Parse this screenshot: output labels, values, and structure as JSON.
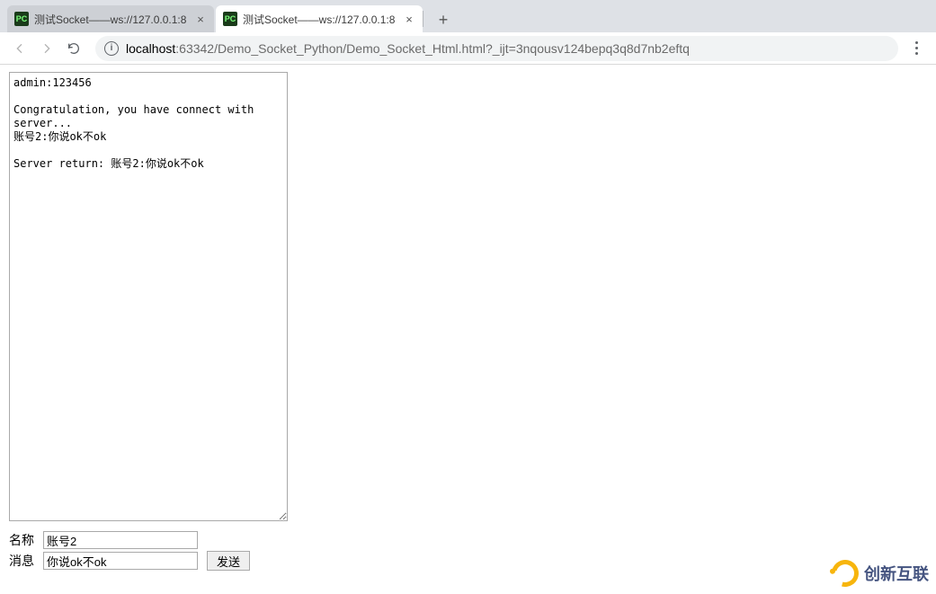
{
  "browser": {
    "tabs": [
      {
        "title": "测试Socket——ws://127.0.0.1:8",
        "favicon": "PC",
        "active": false
      },
      {
        "title": "测试Socket——ws://127.0.0.1:8",
        "favicon": "PC",
        "active": true
      }
    ],
    "url_host": "localhost",
    "url_port": ":63342",
    "url_path": "/Demo_Socket_Python/Demo_Socket_Html.html?_ijt=3nqousv124bepq3q8d7nb2eftq"
  },
  "log": {
    "lines": [
      "admin:123456",
      "",
      "Congratulation, you have connect with",
      "server...",
      "账号2:你说ok不ok",
      "",
      "Server return: 账号2:你说ok不ok"
    ]
  },
  "form": {
    "name_label": "名称",
    "name_value": "账号2",
    "message_label": "消息",
    "message_value": "你说ok不ok",
    "send_label": "发送"
  },
  "watermark": {
    "text": "创新互联"
  }
}
